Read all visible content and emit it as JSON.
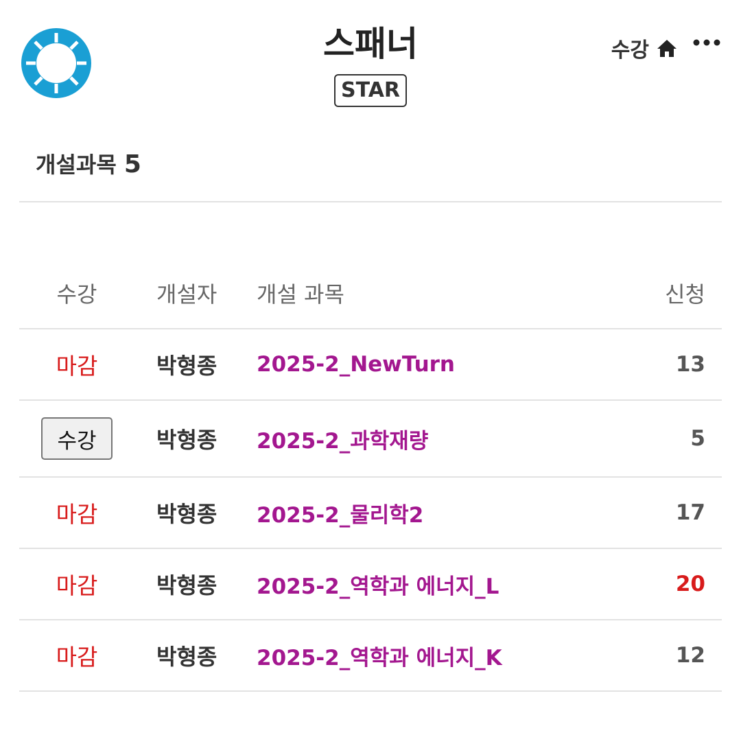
{
  "header": {
    "title": "스패너",
    "badge": "STAR",
    "enroll_link": "수강",
    "home_icon": "home-icon",
    "more_icon": "more-icon",
    "logo_icon": "spanner-ring-logo",
    "logo_color": "#1a9fd4"
  },
  "section": {
    "label": "개설과목",
    "count": "5"
  },
  "table": {
    "columns": [
      "수강",
      "개설자",
      "개설 과목",
      "신청"
    ],
    "rows": [
      {
        "status": "마감",
        "status_type": "closed",
        "author": "박형종",
        "course": "2025-2_NewTurn",
        "count": "13",
        "count_full": false
      },
      {
        "status": "수강",
        "status_type": "button",
        "author": "박형종",
        "course": "2025-2_과학재량",
        "count": "5",
        "count_full": false
      },
      {
        "status": "마감",
        "status_type": "closed",
        "author": "박형종",
        "course": "2025-2_물리학2",
        "count": "17",
        "count_full": false
      },
      {
        "status": "마감",
        "status_type": "closed",
        "author": "박형종",
        "course": "2025-2_역학과 에너지_L",
        "count": "20",
        "count_full": true
      },
      {
        "status": "마감",
        "status_type": "closed",
        "author": "박형종",
        "course": "2025-2_역학과 에너지_K",
        "count": "12",
        "count_full": false
      }
    ]
  },
  "colors": {
    "closed": "#d81b1b",
    "course_link": "#a3178f",
    "count_full": "#d81b1b"
  }
}
